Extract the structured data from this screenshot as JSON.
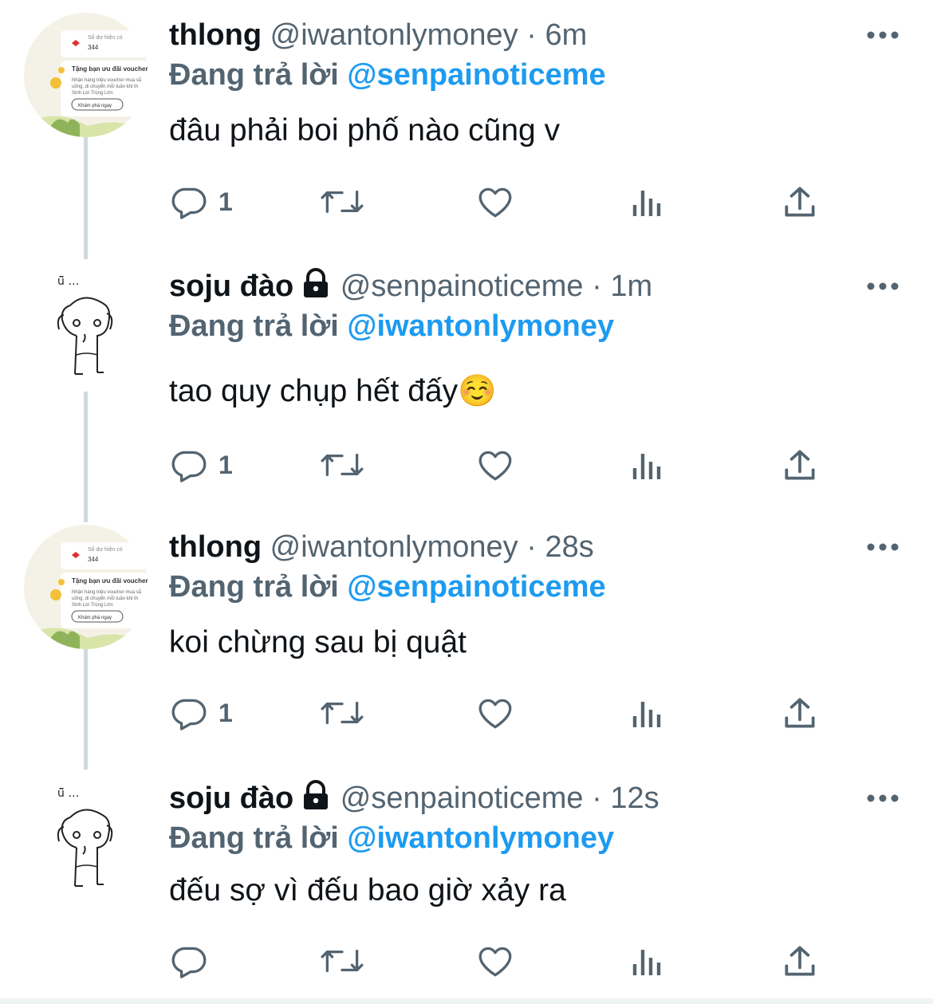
{
  "tweets": [
    {
      "name": "thlong",
      "handle": "@iwantonlymoney",
      "time": "6m",
      "replying_prefix": "Đang trả lời",
      "replying_to": "@senpainoticeme",
      "text": "đâu phải boi phố nào cũng v",
      "reply_count": "1",
      "avatar": "voucher-screenshot",
      "locked": false,
      "avatar_text": {
        "balance_label": "Số dư hiện có",
        "balance": "344",
        "promo": "Tặng bạn ưu đãi voucher",
        "desc1": "Nhận hàng triệu voucher mua sắ",
        "desc2": "uống, di chuyển mỗi tuần khi th",
        "desc3": "Sinh Lời Trùng Lớn",
        "cta": "Khám phá ngay"
      }
    },
    {
      "name": "soju đào",
      "handle": "@senpainoticeme",
      "time": "1m",
      "replying_prefix": "Đang trả lời",
      "replying_to": "@iwantonlymoney",
      "text": "tao quy chụp hết đấy☺️",
      "reply_count": "1",
      "avatar": "dog-doodle",
      "locked": true
    },
    {
      "name": "thlong",
      "handle": "@iwantonlymoney",
      "time": "28s",
      "replying_prefix": "Đang trả lời",
      "replying_to": "@senpainoticeme",
      "text": "koi chừng sau bị quật",
      "reply_count": "1",
      "avatar": "voucher-screenshot",
      "locked": false,
      "avatar_text": {
        "balance_label": "Số dư hiện có",
        "balance": "344",
        "promo": "Tặng bạn ưu đãi voucher",
        "desc1": "Nhận hàng triệu voucher mua sắ",
        "desc2": "uống, di chuyển mỗi tuần khi th",
        "desc3": "Sinh Lời Trùng Lớn",
        "cta": "Khám phá ngay"
      }
    },
    {
      "name": "soju đào",
      "handle": "@senpainoticeme",
      "time": "12s",
      "replying_prefix": "Đang trả lời",
      "replying_to": "@iwantonlymoney",
      "text": "đếu sợ vì đếu bao giờ xảy ra",
      "reply_count": "",
      "avatar": "dog-doodle",
      "locked": true
    }
  ],
  "icons": {
    "reply": "reply-icon",
    "retweet": "retweet-icon",
    "like": "like-icon",
    "views": "views-icon",
    "share": "share-icon",
    "more": "more-icon",
    "lock": "lock-icon"
  },
  "colors": {
    "name": "#0f1419",
    "secondary": "#536471",
    "mention": "#1d9bf0",
    "thread_line": "#cfd9de"
  }
}
